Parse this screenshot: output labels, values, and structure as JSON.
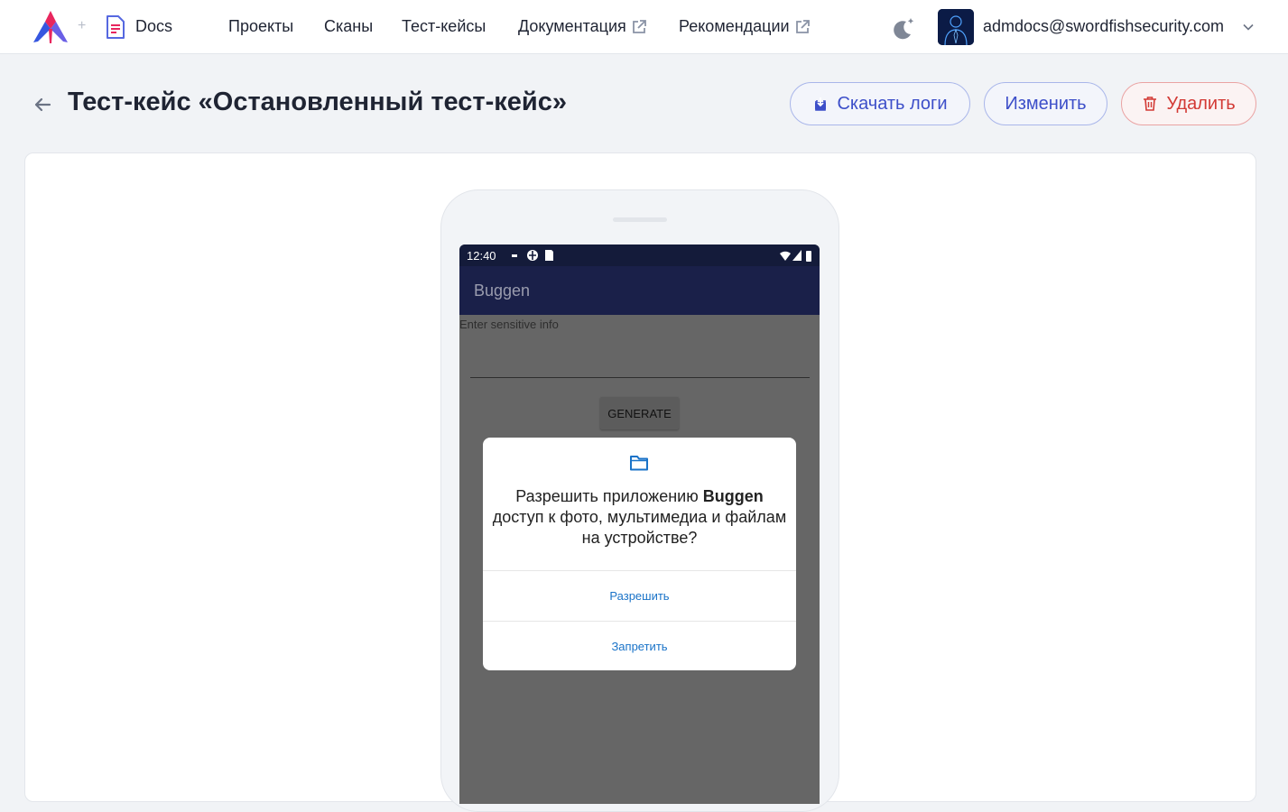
{
  "nav": {
    "product_label": "Docs",
    "plus": "+",
    "links": [
      {
        "label": "Проекты"
      },
      {
        "label": "Сканы"
      },
      {
        "label": "Тест-кейсы"
      },
      {
        "label": "Документация",
        "external": true
      },
      {
        "label": "Рекомендации",
        "external": true
      }
    ],
    "theme_icon": "moon-star-icon",
    "user_email": "admdocs@swordfishsecurity.com"
  },
  "header": {
    "title": "Тест-кейс «Остановленный тест-кейс»",
    "buttons": {
      "download": "Скачать логи",
      "edit": "Изменить",
      "delete": "Удалить"
    }
  },
  "device": {
    "status_time": "12:40",
    "app_title": "Buggen",
    "input_hint": "Enter sensitive info",
    "generate_label": "GENERATE",
    "dialog": {
      "text_before": "Разрешить приложению ",
      "app_name": "Buggen",
      "text_after": " доступ к фото, мультимедиа и файлам на устройстве?",
      "allow": "Разрешить",
      "deny": "Запретить"
    }
  },
  "colors": {
    "primary": "#3d4fc9",
    "danger": "#d33a35",
    "appbar": "#1a2049",
    "statusbar": "#141b3a",
    "dialog_action": "#1a73c8"
  }
}
